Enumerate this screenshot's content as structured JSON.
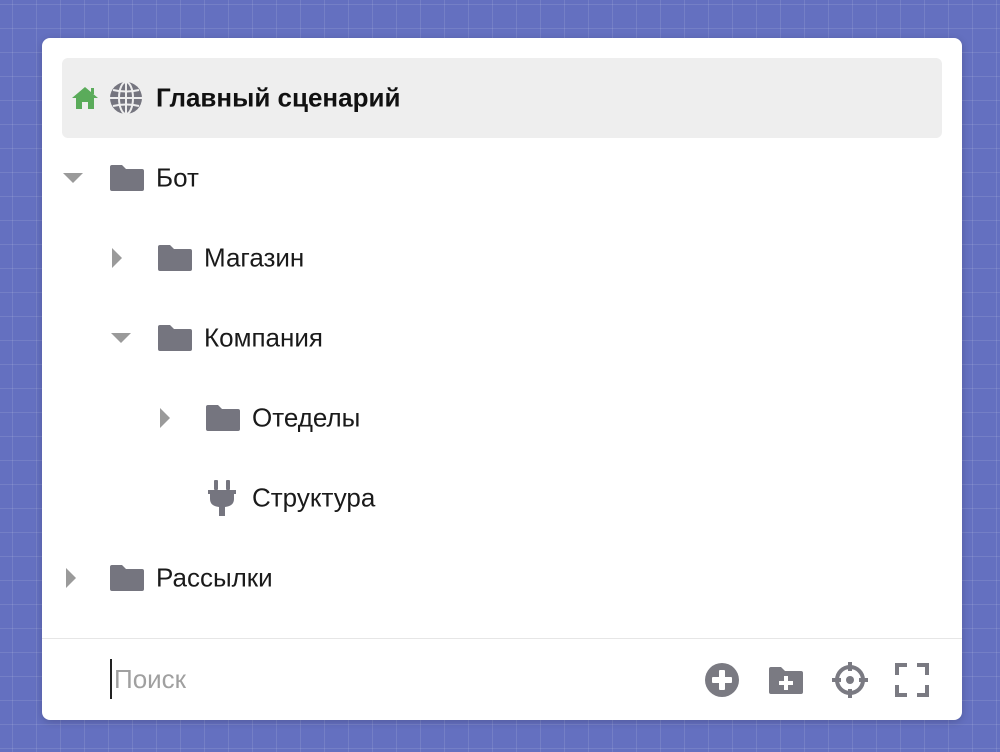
{
  "colors": {
    "background": "#6470c0",
    "folder": "#75757f",
    "home": "#5aab5a",
    "caret": "#9a9a9a",
    "tool": "#7a7a82"
  },
  "tree": {
    "root": {
      "label": "Главный сценарий",
      "icons": [
        "home-icon",
        "globe-icon"
      ]
    },
    "items": [
      {
        "label": "Бот",
        "icon": "folder-icon",
        "expanded": true,
        "depth": 0
      },
      {
        "label": "Магазин",
        "icon": "folder-icon",
        "expanded": false,
        "depth": 1
      },
      {
        "label": "Компания",
        "icon": "folder-icon",
        "expanded": true,
        "depth": 1
      },
      {
        "label": "Отеделы",
        "icon": "folder-icon",
        "expanded": false,
        "depth": 2
      },
      {
        "label": "Структура",
        "icon": "plug-icon",
        "depth": 2
      },
      {
        "label": "Рассылки",
        "icon": "folder-icon",
        "expanded": false,
        "depth": 0
      }
    ]
  },
  "footer": {
    "search_placeholder": "Поиск",
    "search_value": "",
    "tools": [
      "add-circle-icon",
      "add-folder-icon",
      "crosshair-icon",
      "expand-icon"
    ]
  }
}
